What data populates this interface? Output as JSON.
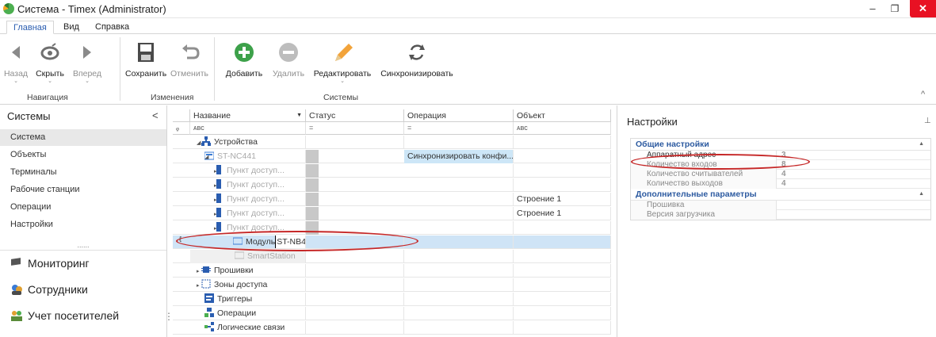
{
  "window": {
    "title": "Система - Timex (Administrator)",
    "controls": {
      "minimize": "–",
      "maximize": "❐",
      "close": "✕"
    }
  },
  "menu_tabs": [
    "Главная",
    "Вид",
    "Справка"
  ],
  "ribbon": {
    "buttons": [
      {
        "label": "Назад",
        "icon": "back-arrow-icon",
        "enabled": false
      },
      {
        "label": "Скрыть",
        "icon": "eye-icon",
        "enabled": true
      },
      {
        "label": "Вперед",
        "icon": "forward-arrow-icon",
        "enabled": false
      },
      {
        "label": "Сохранить",
        "icon": "save-icon",
        "enabled": true
      },
      {
        "label": "Отменить",
        "icon": "undo-icon",
        "enabled": false
      },
      {
        "label": "Добавить",
        "icon": "add-icon",
        "enabled": true
      },
      {
        "label": "Удалить",
        "icon": "remove-icon",
        "enabled": false
      },
      {
        "label": "Редактировать",
        "icon": "pencil-icon",
        "enabled": true
      },
      {
        "label": "Синхронизировать",
        "icon": "sync-icon",
        "enabled": true
      }
    ],
    "groups": [
      "Навигация",
      "Изменения",
      "Системы"
    ],
    "collapse": "^"
  },
  "left_panel": {
    "header": "Системы",
    "collapse_arrow": "<",
    "items": [
      "Система",
      "Объекты",
      "Терминалы",
      "Рабочие станции",
      "Операции",
      "Настройки"
    ],
    "dots": "......",
    "nav": [
      "Мониторинг",
      "Сотрудники",
      "Учет посетителей"
    ],
    "grip": "⋮"
  },
  "grid": {
    "columns": [
      "Название",
      "Статус",
      "Операция",
      "Объект"
    ],
    "filters": {
      "name": "ᴀʙc",
      "status": "=",
      "op": "=",
      "obj": "ᴀʙc"
    },
    "rows": [
      {
        "name": "Устройства",
        "status": "",
        "operation": "",
        "object": ""
      },
      {
        "name": "ST-NC441",
        "status": "",
        "operation": "Синхронизировать конфи...",
        "object": ""
      },
      {
        "name": "Пункт доступ...",
        "status": "",
        "operation": "",
        "object": ""
      },
      {
        "name": "Пункт доступ...",
        "status": "",
        "operation": "",
        "object": ""
      },
      {
        "name": "Пункт доступ...",
        "status": "",
        "operation": "",
        "object": "Строение 1"
      },
      {
        "name": "Пункт доступ...",
        "status": "",
        "operation": "",
        "object": "Строение 1"
      },
      {
        "name": "Пункт доступ...",
        "status": "",
        "operation": "",
        "object": ""
      },
      {
        "name": "Модуль",
        "edit_value": "ST-NB4!",
        "status": "",
        "operation": "",
        "object": ""
      },
      {
        "name": "SmartStation",
        "status": "",
        "operation": "",
        "object": ""
      },
      {
        "name": "Прошивки",
        "status": "",
        "operation": "",
        "object": ""
      },
      {
        "name": "Зоны доступа",
        "status": "",
        "operation": "",
        "object": ""
      },
      {
        "name": "Триггеры",
        "status": "",
        "operation": "",
        "object": ""
      },
      {
        "name": "Операции",
        "status": "",
        "operation": "",
        "object": ""
      },
      {
        "name": "Логические связи",
        "status": "",
        "operation": "",
        "object": ""
      }
    ]
  },
  "right_panel": {
    "header": "Настройки",
    "pin": "⊥",
    "categories": [
      {
        "title": "Общие настройки",
        "props": [
          {
            "key": "Аппаратный адрес",
            "value": "3"
          },
          {
            "key": "Количество входов",
            "value": "8"
          },
          {
            "key": "Количество считывателей",
            "value": "4"
          },
          {
            "key": "Количество выходов",
            "value": "4"
          }
        ]
      },
      {
        "title": "Дополнительные параметры",
        "props": [
          {
            "key": "Прошивка",
            "value": ""
          },
          {
            "key": "Версия загрузчика",
            "value": ""
          }
        ]
      }
    ]
  },
  "colors": {
    "accent": "#2c5aa0",
    "selection": "#cfe4f6",
    "annotation": "#c62828",
    "close": "#e81123"
  }
}
